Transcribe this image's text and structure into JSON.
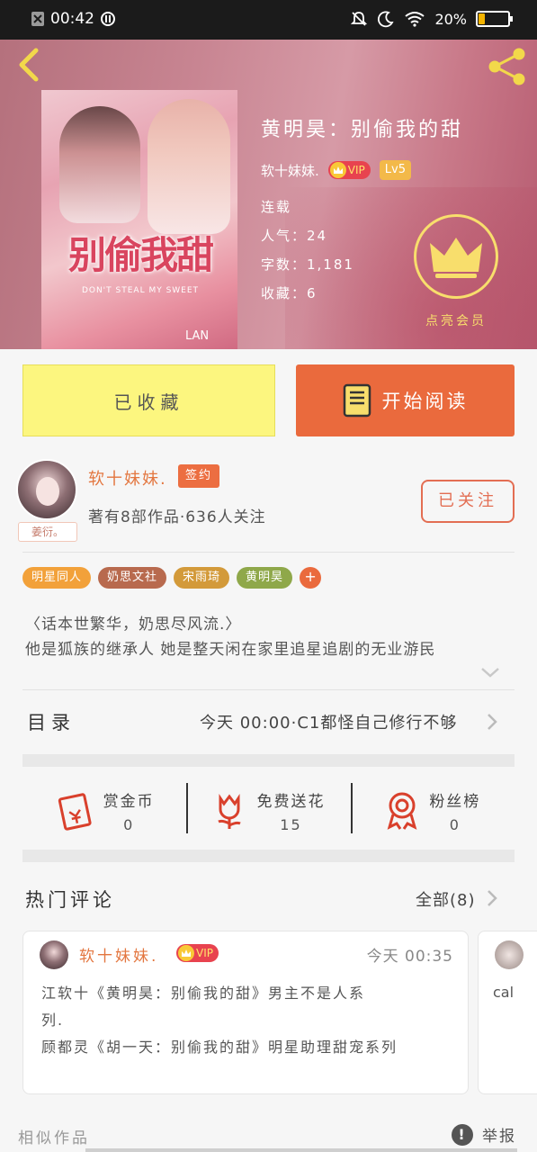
{
  "status_bar": {
    "time": "00:42",
    "battery": "20%",
    "battery_level": 0.2
  },
  "book": {
    "title": "黄明昊：别偷我的甜",
    "author": "软十妹妹.",
    "vip_label": "VIP",
    "level": "Lv5",
    "status": "连载",
    "popularity": "人气：24",
    "word_count": "字数：1,181",
    "favorites": "收藏：6",
    "cover_title": "别偷我甜",
    "cover_subtitle": "DON'T STEAL MY SWEET",
    "cover_mark": "LAN"
  },
  "member": {
    "label": "点亮会员"
  },
  "actions": {
    "collected": "已收藏",
    "read": "开始阅读"
  },
  "author_card": {
    "name": "软十妹妹.",
    "signed": "签约",
    "works": "著有8部作品·636人关注",
    "avatar_tag": "姜衍。",
    "follow": "已关注"
  },
  "tags": [
    {
      "label": "明星同人",
      "color": "#f2a13a"
    },
    {
      "label": "奶思文社",
      "color": "#b86a4e"
    },
    {
      "label": "宋雨琦",
      "color": "#d39a3a"
    },
    {
      "label": "黄明昊",
      "color": "#8fa84a"
    }
  ],
  "tag_more": "+",
  "intro": {
    "line1": "〈话本世繁华，奶思尽风流.〉",
    "line2": "他是狐族的继承人 她是整天闲在家里追星追剧的无业游民"
  },
  "catalog": {
    "label": "目录",
    "latest": "今天 00:00·C1都怪自己修行不够"
  },
  "rewards": [
    {
      "label": "赏金币",
      "value": "0",
      "icon": "red-envelope-icon"
    },
    {
      "label": "免费送花",
      "value": "15",
      "icon": "flower-icon"
    },
    {
      "label": "粉丝榜",
      "value": "0",
      "icon": "medal-icon"
    }
  ],
  "comments_section": {
    "title": "热门评论",
    "all": "全部(8)"
  },
  "comments": [
    {
      "name": "软十妹妹.",
      "vip": "VIP",
      "time": "今天 00:35",
      "line1": "江软十《黄明昊：别偷我的甜》男主不是人系",
      "line2": "列.",
      "line3": "顾都灵《胡一天：别偷我的甜》明星助理甜宠系列"
    },
    {
      "text": "cal"
    }
  ],
  "footer": {
    "similar": "相似作品",
    "report": "举报"
  },
  "colors": {
    "accent": "#ea6a3d",
    "gold": "#f8de6c",
    "collected_bg": "#fcf67f"
  }
}
